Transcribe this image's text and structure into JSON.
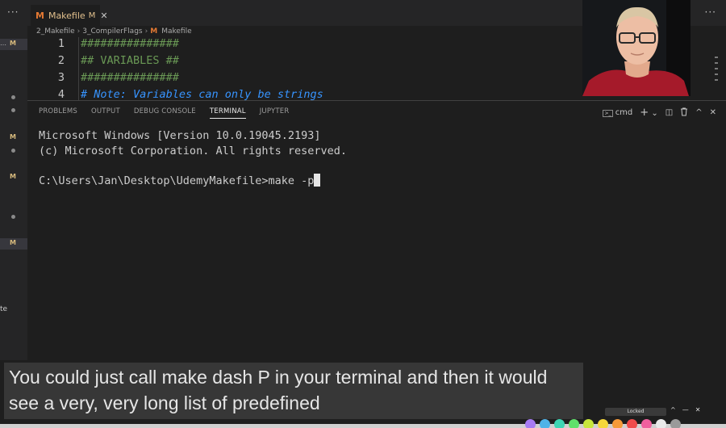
{
  "sidebar": {
    "menu_glyph": "···",
    "rows": [
      {
        "type": "ellipsis",
        "text": "…",
        "badge": "M",
        "selected": true
      },
      {
        "type": "dot"
      },
      {
        "type": "dot"
      },
      {
        "type": "badge",
        "badge": "M"
      },
      {
        "type": "dot"
      },
      {
        "type": "badge",
        "badge": "M"
      },
      {
        "type": "dot"
      },
      {
        "type": "badge",
        "badge": "M",
        "selected": true
      }
    ],
    "fragment": "te"
  },
  "editor": {
    "tab": {
      "icon": "M",
      "label": "Makefile",
      "modified": "M",
      "close": "✕"
    },
    "tabbar_menu": "···",
    "editor_menu": "···",
    "breadcrumb": {
      "parts": [
        "2_Makefile",
        "3_CompilerFlags"
      ],
      "file_icon": "M",
      "file": "Makefile",
      "separator": "›"
    },
    "lines": [
      {
        "n": "1",
        "text": "###############",
        "style": "comment"
      },
      {
        "n": "2",
        "text": "## VARIABLES ##",
        "style": "comment"
      },
      {
        "n": "3",
        "text": "###############",
        "style": "comment"
      },
      {
        "n": "4",
        "text": "# Note: Variables can only be strings",
        "style": "italic-blue"
      }
    ]
  },
  "panel": {
    "tabs": [
      "PROBLEMS",
      "OUTPUT",
      "DEBUG CONSOLE",
      "TERMINAL",
      "JUPYTER"
    ],
    "active_tab": "TERMINAL",
    "shell_label": "cmd",
    "actions": {
      "add": "+",
      "dropdown": "⌄",
      "split": "◫",
      "trash": "🗑",
      "maximize": "^",
      "close": "✕"
    },
    "terminal": {
      "line1": "Microsoft Windows [Version 10.0.19045.2193]",
      "line2": "(c) Microsoft Corporation. All rights reserved.",
      "line3": "",
      "prompt": "C:\\Users\\Jan\\Desktop\\UdemyMakefile>",
      "command": "make -p"
    }
  },
  "caption": {
    "line1": "You could just call make dash P in your terminal and then it would",
    "line2": "see a very, very long list of predefined"
  },
  "overlay": {
    "lock_label": "Locked",
    "controls": [
      "^",
      "—",
      "✕"
    ],
    "palette": [
      "#a77bf3",
      "#4fb3e8",
      "#3cd6b4",
      "#5fe06a",
      "#c8e63c",
      "#f5d73a",
      "#f59a3a",
      "#ef4b4b",
      "#f0609e",
      "#e9e9e9",
      "#9a9a9a"
    ]
  },
  "colors": {
    "accent_orange": "#e37933",
    "modified": "#e2c08d",
    "comment_green": "#6a9955",
    "comment_blue": "#3794ff"
  }
}
